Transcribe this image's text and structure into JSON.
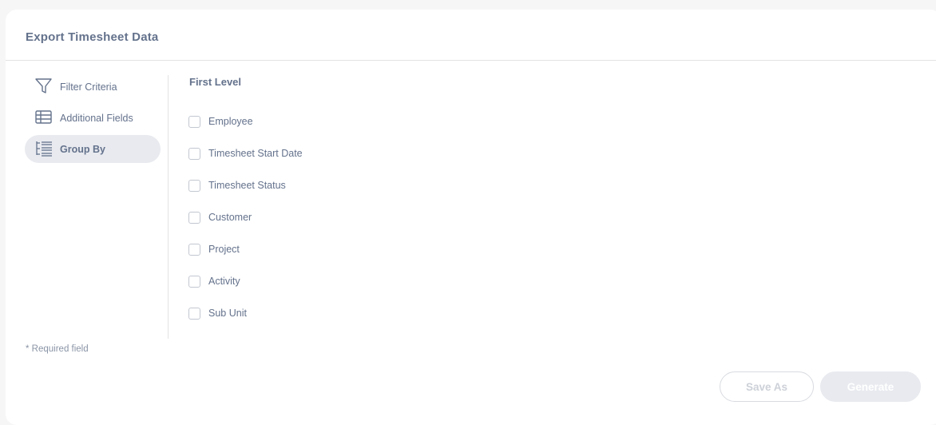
{
  "header": {
    "title": "Export Timesheet Data"
  },
  "sidebar": {
    "items": [
      {
        "label": "Filter Criteria",
        "icon": "filter-icon"
      },
      {
        "label": "Additional Fields",
        "icon": "table-icon"
      },
      {
        "label": "Group By",
        "icon": "group-by-icon",
        "active": true
      }
    ]
  },
  "footer_note": "* Required field",
  "main": {
    "section_title": "First Level",
    "options": [
      {
        "label": "Employee",
        "checked": false
      },
      {
        "label": "Timesheet Start Date",
        "checked": false
      },
      {
        "label": "Timesheet Status",
        "checked": false
      },
      {
        "label": "Customer",
        "checked": false
      },
      {
        "label": "Project",
        "checked": false
      },
      {
        "label": "Activity",
        "checked": false
      },
      {
        "label": "Sub Unit",
        "checked": false
      }
    ]
  },
  "actions": {
    "save_as_label": "Save As",
    "generate_label": "Generate"
  },
  "colors": {
    "text": "#64728c",
    "active_bg": "#e8eaef",
    "divider": "#e3e3e3"
  }
}
